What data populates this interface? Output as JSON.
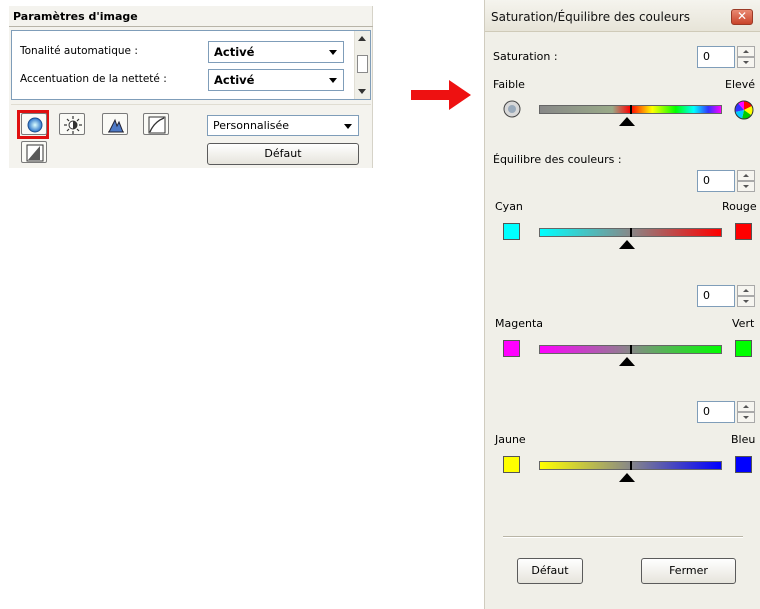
{
  "left_panel": {
    "title": "Paramètres d'image",
    "rows": [
      {
        "label": "Tonalité automatique :",
        "value": "Activé"
      },
      {
        "label": "Accentuation de la netteté :",
        "value": "Activé"
      }
    ],
    "tool_icons": [
      "saturation-color-balance-icon",
      "brightness-contrast-icon",
      "histogram-icon",
      "tone-curve-icon",
      "final-review-icon"
    ],
    "preset_value": "Personnalisée",
    "default_button": "Défaut"
  },
  "dialog": {
    "title": "Saturation/Équilibre des couleurs",
    "close_label": "✕",
    "saturation": {
      "label": "Saturation :",
      "value": "0",
      "low_label": "Faible",
      "high_label": "Elevé"
    },
    "color_balance_label": "Équilibre des couleurs :",
    "balances": [
      {
        "value": "0",
        "left_label": "Cyan",
        "right_label": "Rouge",
        "left_color": "#00ffff",
        "right_color": "#ff0000"
      },
      {
        "value": "0",
        "left_label": "Magenta",
        "right_label": "Vert",
        "left_color": "#ff00ff",
        "right_color": "#00ff00"
      },
      {
        "value": "0",
        "left_label": "Jaune",
        "right_label": "Bleu",
        "left_color": "#ffff00",
        "right_color": "#0000ff"
      }
    ],
    "default_button": "Défaut",
    "close_button": "Fermer"
  },
  "colors": {
    "highlight": "#e01010",
    "arrow": "#ee1111"
  }
}
